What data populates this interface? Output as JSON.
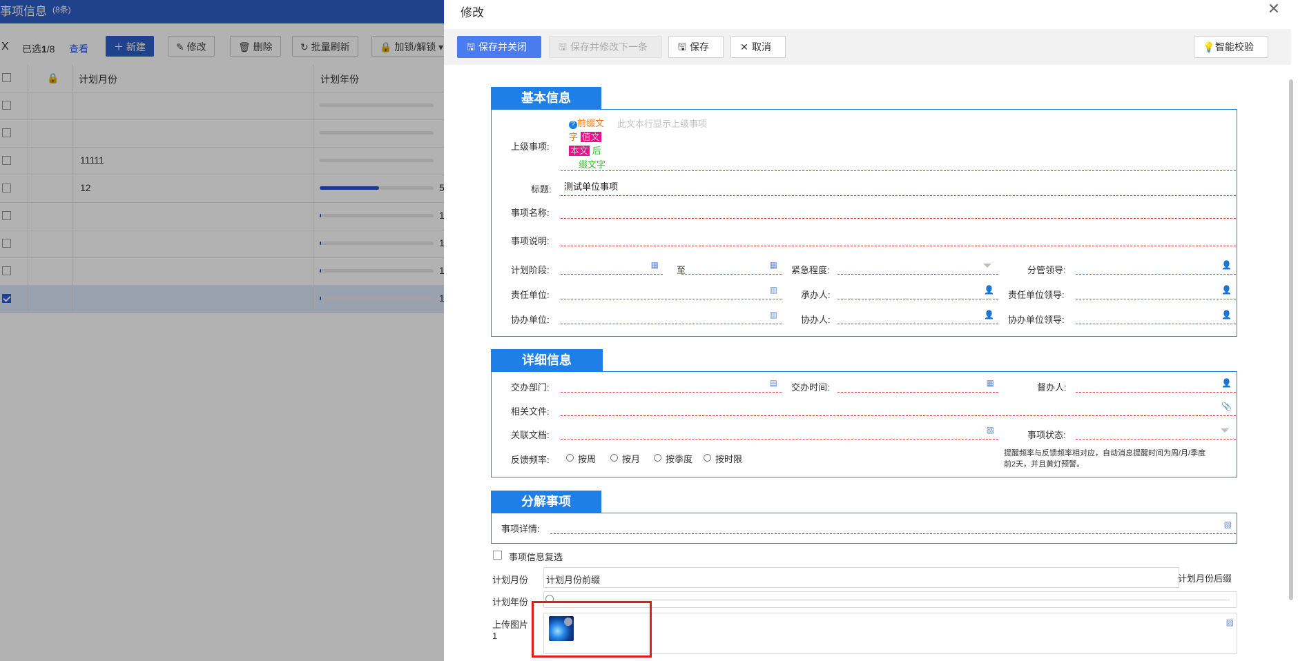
{
  "background": {
    "header_title": "事项信息",
    "header_count": "(8条)",
    "close_glyph": "X",
    "selected_label": "已选",
    "selected_count": "1",
    "selected_total": "/8",
    "view_link": "查看",
    "buttons": {
      "new": "新建",
      "edit": "修改",
      "delete": "删除",
      "batch_refresh": "批量刷新",
      "lock_unlock": "加锁/解锁"
    },
    "columns": [
      "计划月份",
      "计划年份"
    ],
    "rows": [
      {
        "month": "",
        "year_text": "",
        "progress": 0,
        "checked": false
      },
      {
        "month": "",
        "year_text": "",
        "progress": 0,
        "checked": false
      },
      {
        "month": "11111",
        "year_text": "",
        "progress": 0,
        "checked": false
      },
      {
        "month": "12",
        "year_text": "5",
        "progress": 0.52,
        "checked": false
      },
      {
        "month": "",
        "year_text": "1",
        "progress": 0.01,
        "checked": false
      },
      {
        "month": "",
        "year_text": "1",
        "progress": 0.01,
        "checked": false
      },
      {
        "month": "",
        "year_text": "1",
        "progress": 0.01,
        "checked": false
      },
      {
        "month": "",
        "year_text": "1",
        "progress": 0.01,
        "checked": true
      }
    ]
  },
  "modal": {
    "title": "修改",
    "close_glyph": "✕",
    "toolbar": {
      "save_close": "保存并关闭",
      "save_next": "保存并修改下一条",
      "save": "保存",
      "cancel": "取消",
      "smart_check": "智能校验"
    },
    "section_basic": {
      "tab": "基本信息",
      "parent_label": "上级事项:",
      "prefix_text_a": "前缀文",
      "prefix_text_b": "字",
      "value_text_a": "值文",
      "value_text_b": "本文",
      "suffix_text_a": "后",
      "suffix_text_b": "缀文字",
      "parent_placeholder": "此文本行显示上级事项",
      "title_label": "标题:",
      "title_value": "测试单位事项",
      "name_label": "事项名称:",
      "desc_label": "事项说明:",
      "stage_label": "计划阶段:",
      "to_label": "至",
      "urgency_label": "紧急程度:",
      "leader_label": "分管领导:",
      "resp_unit_label": "责任单位:",
      "handler_label": "承办人:",
      "resp_leader_label": "责任单位领导:",
      "co_unit_label": "协办单位:",
      "co_person_label": "协办人:",
      "co_leader_label": "协办单位领导:"
    },
    "section_detail": {
      "tab": "详细信息",
      "dept_label": "交办部门:",
      "time_label": "交办时间:",
      "supervisor_label": "督办人:",
      "files_label": "相关文件:",
      "docs_label": "关联文档:",
      "status_label": "事项状态:",
      "freq_label": "反馈频率:",
      "freq_options": [
        "按周",
        "按月",
        "按季度",
        "按时限"
      ],
      "freq_note_1": "提醒频率与反馈频率相对应，自动消息提醒时间为周/月/季度",
      "freq_note_2": "前2天，并且黄灯预警。"
    },
    "section_split": {
      "tab": "分解事项",
      "detail_label": "事项详情:"
    },
    "recheck_label": "事项信息复选",
    "month_label": "计划月份",
    "month_prefix": "计划月份前缀",
    "month_suffix": "计划月份后缀",
    "year_label": "计划年份",
    "year_progress": 0,
    "upload_label": "上传图片",
    "upload_count": "1"
  },
  "colors": {
    "primary_blue": "#1e7fe8",
    "required_dash": "#e63b3b",
    "highlight_red": "#e21b1b",
    "prefix_orange": "#f07b1c",
    "value_magenta": "#e8128c",
    "suffix_green": "#2fc52f"
  }
}
